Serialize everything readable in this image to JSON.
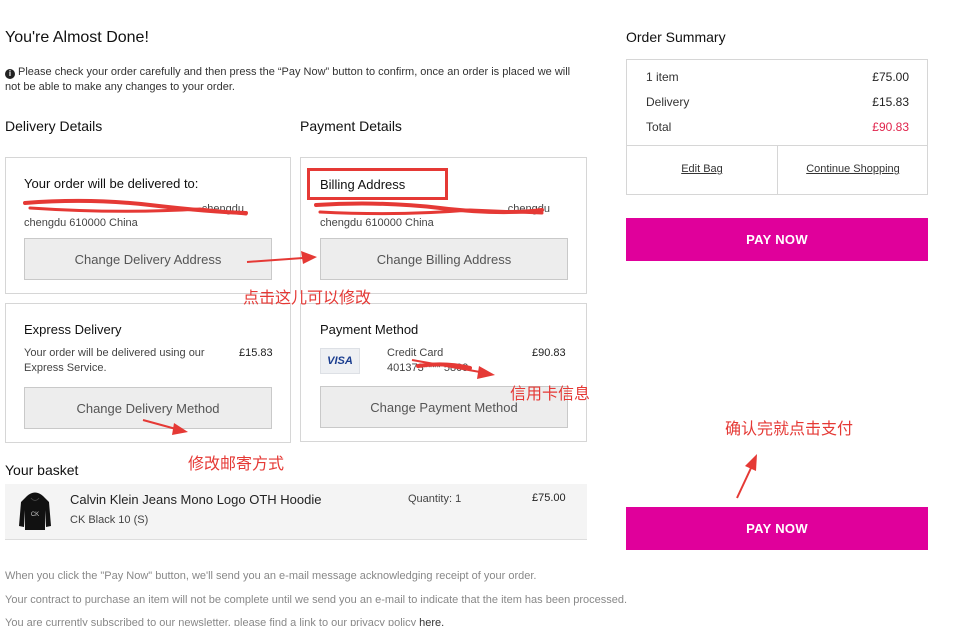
{
  "page": {
    "title": "You're Almost Done!",
    "notice": "Please check your order carefully and then press the “Pay Now” button to confirm, once an order is placed we will not be able to make any changes to your order."
  },
  "delivery_details": {
    "heading": "Delivery Details",
    "card_title": "Your order will be delivered to:",
    "address_line1": "chengdu",
    "address_line2": "chengdu 610000 China",
    "change_button": "Change Delivery Address"
  },
  "payment_details": {
    "heading": "Payment Details",
    "card_title": "Billing Address",
    "address_line1": "chengdu",
    "address_line2": "chengdu 610000 China",
    "change_button": "Change Billing Address"
  },
  "express_delivery": {
    "title": "Express Delivery",
    "desc": "Your order will be delivered using our Express Service.",
    "price": "£15.83",
    "change_button": "Change Delivery Method"
  },
  "payment_method": {
    "title": "Payment Method",
    "card_brand": "VISA",
    "card_type": "Credit Card",
    "card_number": "401373**** 5809",
    "amount": "£90.83",
    "change_button": "Change Payment Method"
  },
  "basket": {
    "heading": "Your basket",
    "item_name": "Calvin Klein Jeans Mono Logo OTH Hoodie",
    "item_variant": "CK Black 10 (S)",
    "quantity": "Quantity: 1",
    "price": "£75.00"
  },
  "summary": {
    "heading": "Order Summary",
    "rows": [
      {
        "label": "1 item",
        "value": "£75.00"
      },
      {
        "label": "Delivery",
        "value": "£15.83"
      },
      {
        "label": "Total",
        "value": "£90.83"
      }
    ],
    "edit_bag": "Edit Bag",
    "continue_shopping": "Continue Shopping",
    "pay_now": "PAY NOW"
  },
  "footer": {
    "line1": "When you click the \"Pay Now\" button, we'll send you an e-mail message acknowledging receipt of your order.",
    "line2": "Your contract to purchase an item will not be complete until we send you an e-mail to indicate that the item has been processed.",
    "line3": "You are currently subscribed to our newsletter, please find a link to our privacy policy",
    "line3_link": "here."
  },
  "annotations": {
    "modify_here": "点击这儿可以修改",
    "card_info": "信用卡信息",
    "modify_shipping": "修改邮寄方式",
    "confirm_pay": "确认完就点击支付"
  },
  "colors": {
    "pay_button": "#e0009b",
    "total_red": "#e0244c",
    "annotation_red": "#e53935"
  }
}
